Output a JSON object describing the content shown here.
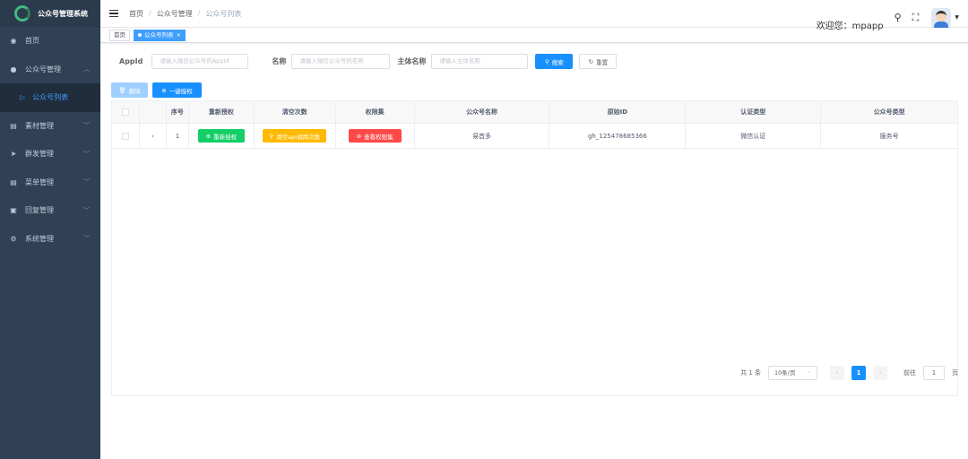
{
  "app": {
    "title": "公众号管理系统"
  },
  "sidebar": {
    "items": [
      {
        "label": "首页",
        "icon": "dashboard-icon"
      },
      {
        "label": "公众号管理",
        "icon": "wechat-icon",
        "expanded": true
      },
      {
        "label": "公众号列表",
        "icon": "list-icon",
        "active": true
      },
      {
        "label": "素材管理",
        "icon": "document-icon"
      },
      {
        "label": "群发管理",
        "icon": "send-icon"
      },
      {
        "label": "菜单管理",
        "icon": "menu-icon"
      },
      {
        "label": "回复管理",
        "icon": "reply-icon"
      },
      {
        "label": "系统管理",
        "icon": "gear-icon"
      }
    ]
  },
  "header": {
    "breadcrumb": [
      "首页",
      "公众号管理",
      "公众号列表"
    ],
    "welcome": "欢迎您：mpapp"
  },
  "tags": {
    "home": "首页",
    "current": "公众号列表"
  },
  "search": {
    "appid_label": "AppId",
    "appid_placeholder": "请输入微信公众号的AppId",
    "name_label": "名称",
    "name_placeholder": "请输入微信公众号的名称",
    "subject_label": "主体名称",
    "subject_placeholder": "请输入主体名称",
    "search_button": "搜索",
    "reset_button": "重置"
  },
  "actions": {
    "delete_button": "删除",
    "authorize_button": "一键授权"
  },
  "table": {
    "headers": [
      "序号",
      "重新授权",
      "清空次数",
      "权限集",
      "公众号名称",
      "原始ID",
      "认证类型",
      "公众号类型"
    ],
    "rows": [
      {
        "index": "1",
        "reauth": "重新授权",
        "clear": "清空api调用次数",
        "perms": "查看权限集",
        "name": "易首多",
        "original_id": "gh_125478685366",
        "auth_type": "微信认证",
        "account_type": "服务号"
      }
    ]
  },
  "pagination": {
    "total": "共 1 条",
    "page_size": "10条/页",
    "current_page": "1",
    "goto_label": "前往",
    "goto_value": "1",
    "page_suffix": "页"
  },
  "colors": {
    "sidebar_bg": "#304156",
    "primary": "#1890ff",
    "success": "#13ce66",
    "warning": "#ffba00",
    "danger": "#ff4949"
  }
}
